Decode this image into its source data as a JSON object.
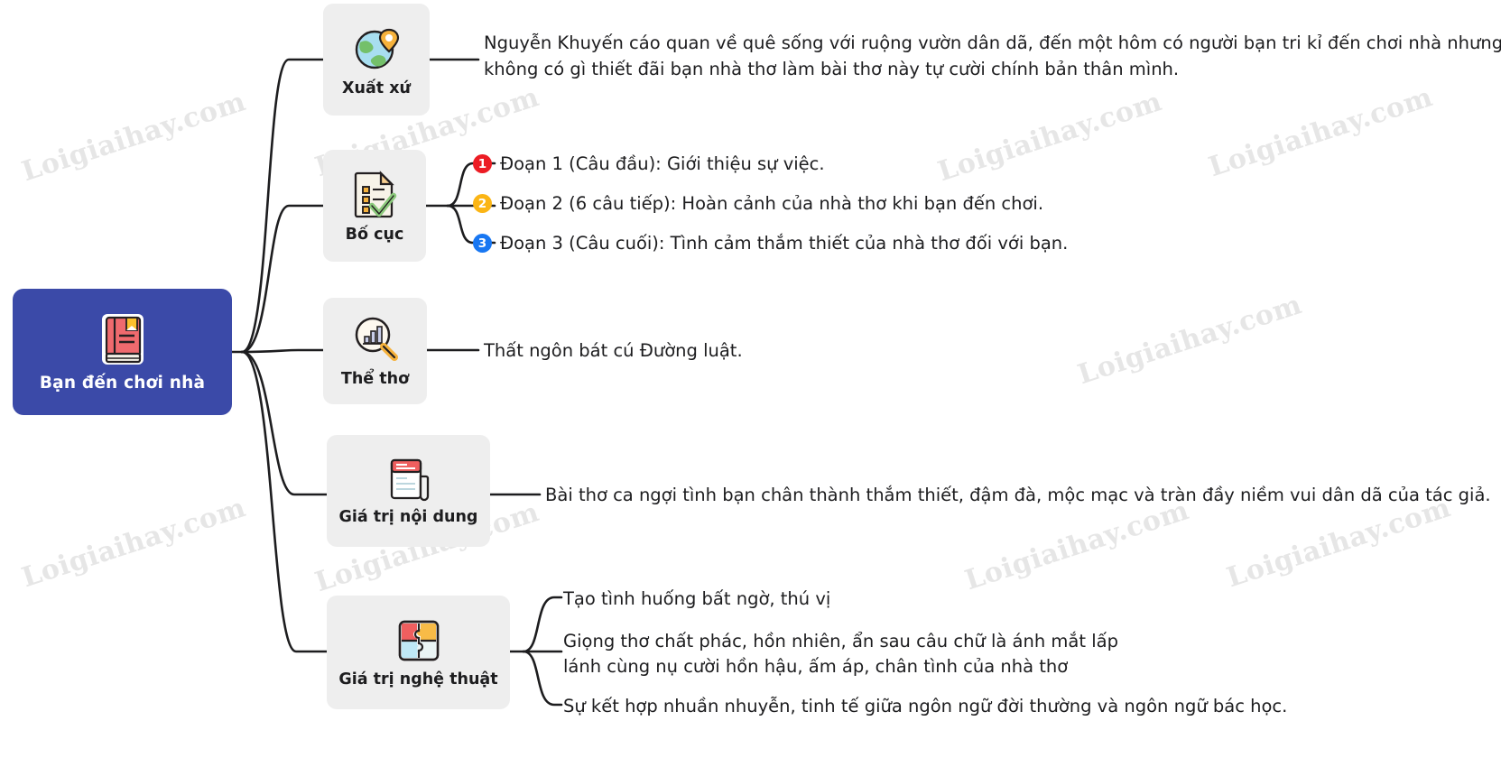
{
  "root": {
    "label": "Bạn đến chơi nhà",
    "icon": "red-book-icon",
    "color": "#3b4aa8"
  },
  "branches": [
    {
      "id": "xuat-xu",
      "label": "Xuất xứ",
      "icon": "globe-location-pin-icon",
      "leaves": [
        {
          "text": "Nguyễn Khuyến cáo quan về quê sống với ruộng vườn dân dã, đến một hôm có người bạn tri kỉ đến chơi nhà nhưng không có gì thiết đãi bạn nhà thơ làm bài thơ này tự cười chính bản thân mình."
        }
      ]
    },
    {
      "id": "bo-cuc",
      "label": "Bố cục",
      "icon": "checklist-document-icon",
      "leaves": [
        {
          "number": "1",
          "color": "#ec1c24",
          "text": "Đoạn 1 (Câu đầu): Giới thiệu sự việc."
        },
        {
          "number": "2",
          "color": "#fbb515",
          "text": "Đoạn 2 (6 câu tiếp): Hoàn cảnh của nhà thơ khi bạn đến chơi."
        },
        {
          "number": "3",
          "color": "#1877f2",
          "text": "Đoạn 3 (Câu cuối): Tình cảm thắm thiết của nhà thơ đối với bạn."
        }
      ]
    },
    {
      "id": "the-tho",
      "label": "Thể thơ",
      "icon": "magnifier-bar-chart-icon",
      "leaves": [
        {
          "text": "Thất ngôn bát cú Đường luật."
        }
      ]
    },
    {
      "id": "gia-tri-noi-dung",
      "label": "Giá trị nội dung",
      "icon": "newspaper-icon",
      "leaves": [
        {
          "text": "Bài thơ ca ngợi tình bạn chân thành thắm thiết, đậm đà, mộc mạc và tràn đầy niềm vui dân dã của tác giả."
        }
      ]
    },
    {
      "id": "gia-tri-nghe-thuat",
      "label": "Giá trị nghệ thuật",
      "icon": "puzzle-pieces-icon",
      "leaves": [
        {
          "text": "Tạo tình huống bất ngờ, thú vị"
        },
        {
          "text": "Giọng thơ chất phác, hồn nhiên, ẩn sau câu chữ là ánh mắt lấp lánh cùng nụ cười hồn hậu, ấm áp, chân tình của nhà thơ"
        },
        {
          "text": "Sự kết hợp nhuần nhuyễn, tinh tế giữa ngôn ngữ đời thường và ngôn ngữ bác học."
        }
      ]
    }
  ],
  "watermark": {
    "text": "Loigiaihay.com",
    "color": "#e6e6e6"
  }
}
